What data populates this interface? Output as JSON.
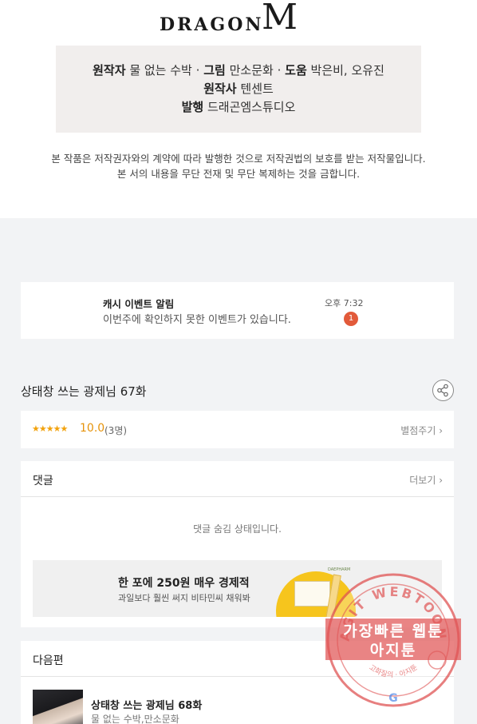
{
  "logo": {
    "text": "DRAGON",
    "mark": "M"
  },
  "credits": {
    "line1": [
      {
        "label": "원작자",
        "value": "물 없는 수박"
      },
      {
        "label": "그림",
        "value": "만소문화"
      },
      {
        "label": "도움",
        "value": "박은비, 오유진"
      }
    ],
    "separator": "·",
    "line2": {
      "label": "원작사",
      "value": "텐센트"
    },
    "line3": {
      "label": "발행",
      "value": "드래곤엠스튜디오"
    }
  },
  "copyright": {
    "line1": "본 작품은 저작권자와의 계약에 따라 발행한 것으로 저작권법의 보호를 받는 저작물입니다.",
    "line2": "본 서의 내용을 무단 전재 및 무단 복제하는 것을 금합니다."
  },
  "notice": {
    "title": "캐시 이벤트 알림",
    "body": "이번주에 확인하지 못한 이벤트가 있습니다.",
    "time": "오후 7:32",
    "badge": "1"
  },
  "episode": {
    "title": "상태창 쓰는 광제님 67화",
    "share_icon": "share-icon"
  },
  "rating": {
    "stars": "★★★★★",
    "score": "10.0",
    "count": "(3명)",
    "rate_link": "별점주기 ›"
  },
  "comments": {
    "title": "댓글",
    "more": "더보기 ›",
    "hidden_msg": "댓글 숨김 상태입니다."
  },
  "ad": {
    "title": "한 포에 250원 매우 경제적",
    "subtitle": "과일보다 훨씬 써지 비타민씨 채워봐",
    "brand": "DAEPHARM"
  },
  "next": {
    "title": "다음편",
    "item_title": "상태창 쓰는 광제님 68화",
    "item_meta": "물 없는 수박,만소문화"
  },
  "watermark": {
    "arc": "AGIT WEBTOON",
    "line1": "가장빠른 웹툰",
    "line2": "아지툰",
    "bottom": "고화질의 · 아지툰"
  },
  "colors": {
    "accent_orange": "#e6930a",
    "badge_red": "#e25a3a",
    "stamp_red": "#e05555"
  }
}
